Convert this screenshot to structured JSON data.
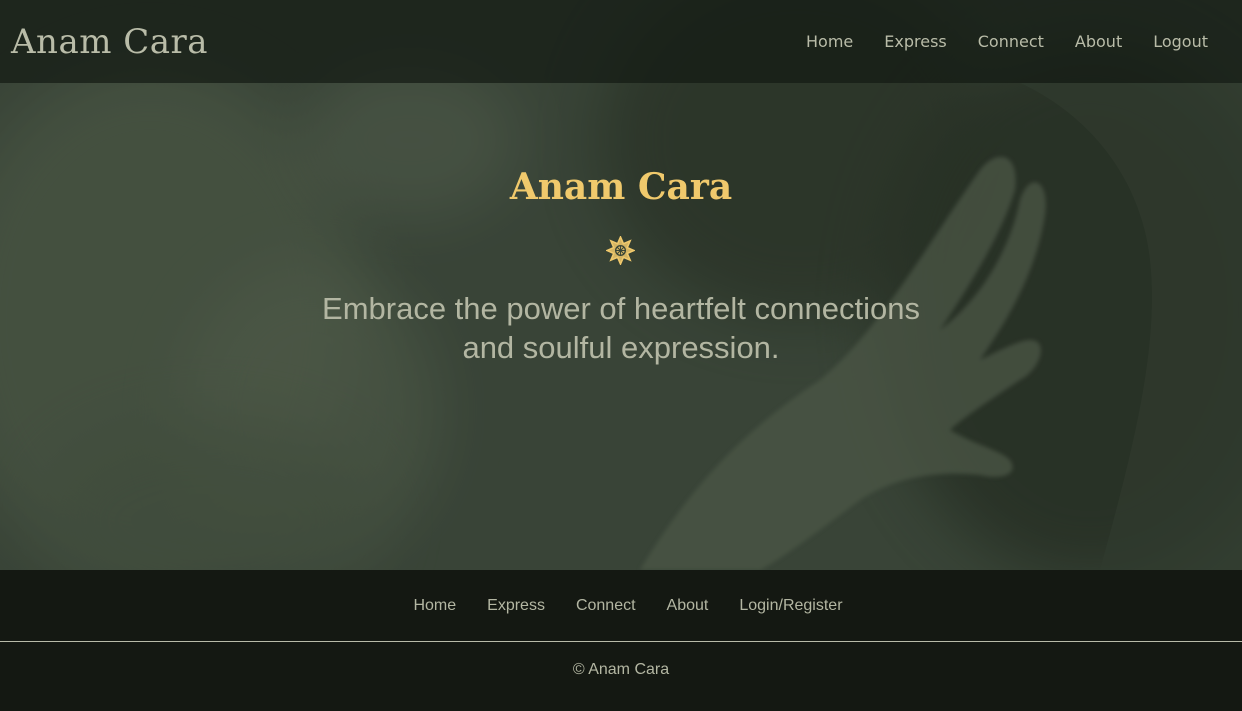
{
  "header": {
    "brand": "Anam Cara",
    "nav": [
      "Home",
      "Express",
      "Connect",
      "About",
      "Logout"
    ]
  },
  "hero": {
    "title": "Anam Cara",
    "icon": "mandala-flower-icon",
    "tagline": "Embrace the power of heartfelt connections and soulful expression."
  },
  "footer": {
    "nav": [
      "Home",
      "Express",
      "Connect",
      "About",
      "Login/Register"
    ],
    "copyright": "© Anam Cara"
  },
  "colors": {
    "accent": "#f0c96c",
    "text": "#b9bca8",
    "background": "#141812"
  }
}
